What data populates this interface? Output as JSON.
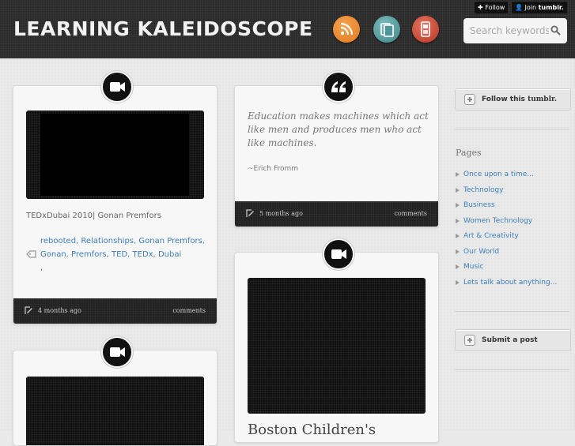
{
  "header": {
    "title": "LEARNING KALEIDOSCOPE",
    "follow_label": "Follow",
    "join_label": "Join",
    "join_brand": "tumblr.",
    "search_placeholder": "Search keywords...",
    "icons": [
      "rss-icon",
      "mobile-pages-icon",
      "phone-icon"
    ]
  },
  "posts": {
    "left_video": {
      "caption": "TEDxDubai 2010| Gonan Premfors",
      "tags": [
        "rebooted,",
        "Relationships,",
        "Gonan",
        "Premfors,",
        "Gonan,",
        "Premfors,",
        "TED,",
        "TEDx,",
        "Dubai"
      ],
      "tag_trailing": ",",
      "time": "4 months ago",
      "comments": "comments"
    },
    "quote": {
      "text": "Education makes machines which act like men and produces men who act like machines.",
      "source": "~Erich Fromm",
      "time": "5 months ago",
      "comments": "comments"
    },
    "right_video": {
      "title": "Boston Children's"
    }
  },
  "sidebar": {
    "follow_button": "Follow this",
    "follow_brand": "tumblr.",
    "pages_heading": "Pages",
    "pages": [
      "Once upon a time...",
      "Technology",
      "Business",
      "Women Technology",
      "Art & Creativity",
      "Our World",
      "Music",
      "Lets talk about anything..."
    ],
    "submit_button": "Submit a post"
  },
  "colors": {
    "link": "#3d7fb7",
    "rss": "#e8832a",
    "mobile": "#4f9496",
    "phone": "#c8412f"
  }
}
